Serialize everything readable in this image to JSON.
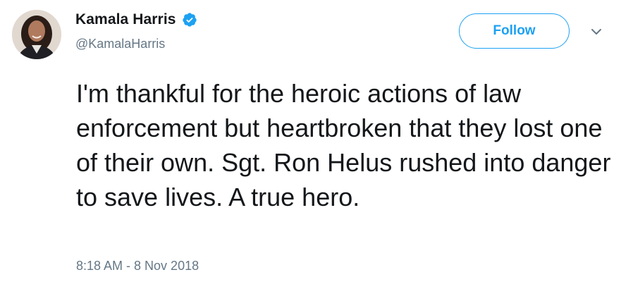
{
  "tweet": {
    "author_name": "Kamala Harris",
    "author_handle": "@KamalaHarris",
    "verified_icon": "verified-badge-icon",
    "follow_label": "Follow",
    "caret_icon": "chevron-down-icon",
    "text": "I'm thankful for the heroic actions of law enforcement but heartbroken that they lost one of their own. Sgt. Ron Helus rushed into danger to save lives. A true hero.",
    "timestamp": "8:18 AM - 8 Nov 2018"
  },
  "colors": {
    "accent": "#1da1f2",
    "text": "#14171a",
    "muted": "#657786"
  }
}
